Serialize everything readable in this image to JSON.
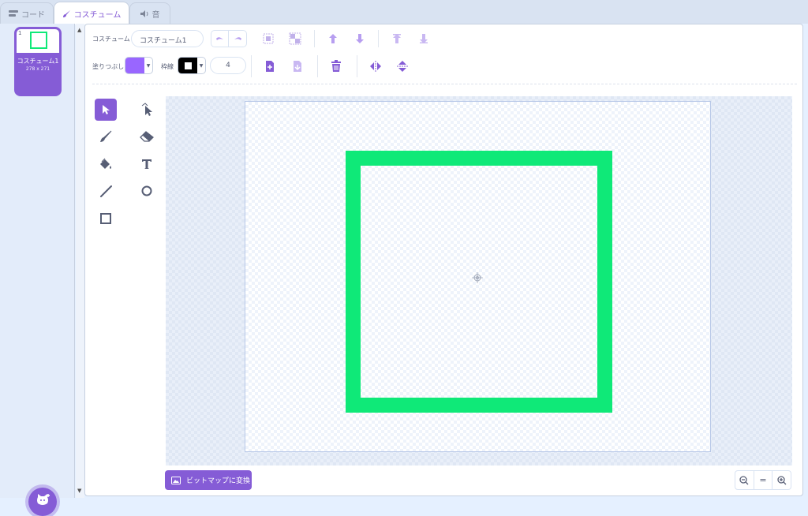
{
  "tabs": {
    "code": "コード",
    "costumes": "コスチューム",
    "sounds": "音"
  },
  "costume_list": {
    "items": [
      {
        "number": "1",
        "name": "コスチューム1",
        "size": "278 x 271"
      }
    ]
  },
  "toolbar": {
    "costume_label": "コスチューム",
    "costume_name": "コスチューム1",
    "fill_label": "塗りつぶし",
    "outline_label": "枠線",
    "outline_width": "4",
    "fill_color": "#9966ff",
    "outline_color": "#000000"
  },
  "canvas": {
    "shape_color": "#0fe978"
  },
  "footer": {
    "convert_label": "ビットマップに変換",
    "zoom_reset": "="
  },
  "colors": {
    "accent": "#855cd6",
    "background": "#e5f0ff"
  }
}
